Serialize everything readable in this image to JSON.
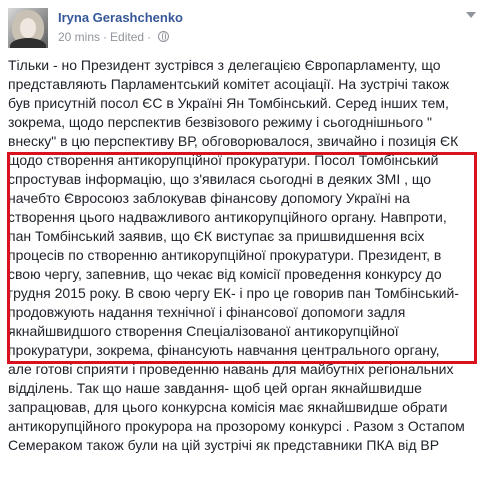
{
  "post": {
    "author": "Iryna Gerashchenko",
    "time": "20 mins",
    "separator": "·",
    "status": "Edited",
    "audience_icon": "globe-icon",
    "menu_icon": "chevron-down-icon",
    "lines": [
      "Тільки - но Президент зустрівся з делегацією Європарламенту, що",
      "представляють Парламентський комітет асоціації. На зустрічі також",
      "був присутній посол ЄС в Україні Ян Томбінський. Серед інших тем,",
      "зокрема, щодо перспектив безвізового режиму і сьогоднішнього \"",
      "внеску\" в цю перспективу ВР, обговорювалося, звичайно і позиція ЄК",
      "щодо створення антикорупційної прокуратури. Посол Томбінський",
      "спростував інформацію, що з'явилася сьогодні в деяких ЗМІ , що",
      "начебто Євросоюз заблокував фінансову допомогу Україні на",
      "створення цього надважливого антикорупційного органу. Навпроти,",
      "пан Томбінський заявив, що ЄК виступає за пришвидшення всіх",
      "процесів по створенню антикорупційної прокуратури. Президент, в",
      "свою чергу, запевнив, що чекає від комісії проведення конкурсу до",
      "грудня 2015 року. В свою чергу ЕК- і про це говорив пан Томбінський-",
      "продовжують надання технічної і фінансової допомоги задля",
      "якнайшвидшого створення Спеціалізованої антикорупційної",
      "прокуратури, зокрема, фінансують навчання центрального органу,",
      "але готові сприяти і проведенню навань для майбутніх регіональних",
      "відділень. Так що наше завдання- щоб цей орган якнайшвидше",
      "запрацював, для цього конкурсна комісія має якнайшвидше обрати",
      "антикорупційного прокурора на прозорому конкурсі . Разом з Остапом",
      "Семераком також були на цій зустрічі як представники ПКА від ВР"
    ]
  },
  "highlight_color": "#d9121f",
  "link_color": "#365899"
}
